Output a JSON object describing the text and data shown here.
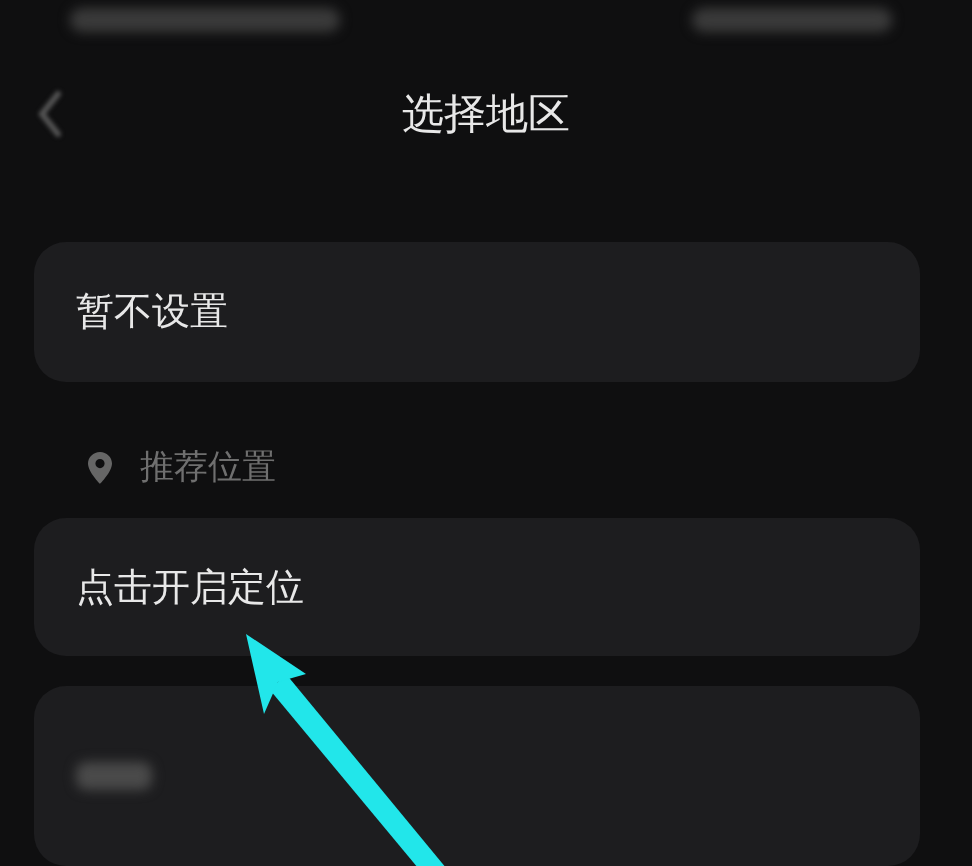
{
  "header": {
    "title": "选择地区"
  },
  "options": [
    {
      "label": "暂不设置"
    }
  ],
  "section": {
    "label": "推荐位置"
  },
  "location_option": {
    "label": "点击开启定位"
  }
}
